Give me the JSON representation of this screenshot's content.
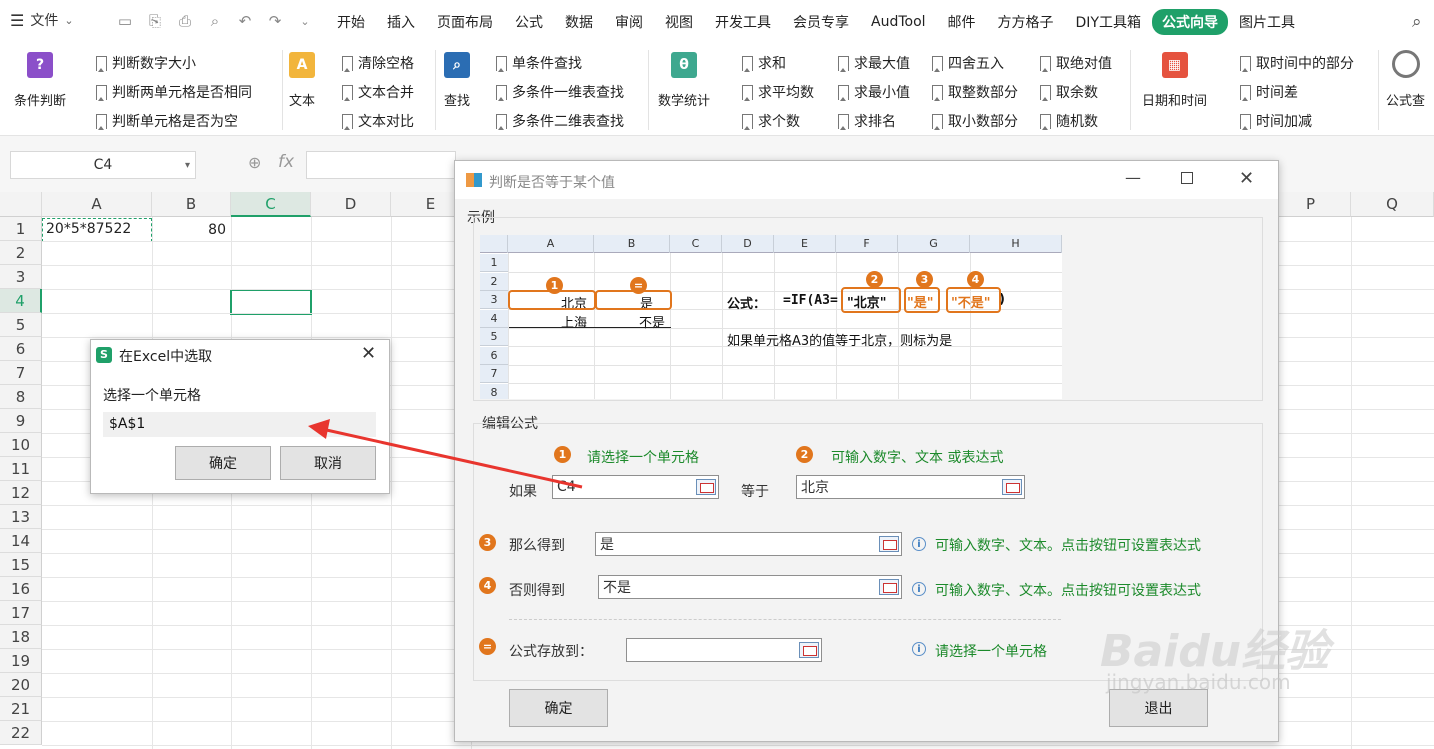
{
  "menubar": {
    "file_label": "文件",
    "tabs": [
      "开始",
      "插入",
      "页面布局",
      "公式",
      "数据",
      "审阅",
      "视图",
      "开发工具",
      "会员专享",
      "AudTool",
      "邮件",
      "方方格子",
      "DIY工具箱",
      "公式向导",
      "图片工具"
    ],
    "active_tab": "公式向导"
  },
  "ribbon": {
    "cond_label": "条件判断",
    "cond_items": [
      "判断数字大小",
      "判断两单元格是否相同",
      "判断单元格是否为空"
    ],
    "text_label": "文本",
    "text_items": [
      "清除空格",
      "文本合并",
      "文本对比"
    ],
    "find_label": "查找",
    "find_items": [
      "单条件查找",
      "多条件一维表查找",
      "多条件二维表查找"
    ],
    "math_label": "数学统计",
    "math_items": [
      "求和",
      "求平均数",
      "求个数"
    ],
    "math_items2": [
      "求最大值",
      "求最小值",
      "求排名"
    ],
    "math_items3": [
      "四舍五入",
      "取整数部分",
      "取小数部分"
    ],
    "math_items4": [
      "取绝对值",
      "取余数",
      "随机数"
    ],
    "date_label": "日期和时间",
    "date_items": [
      "取时间中的部分",
      "时间差",
      "时间加减"
    ],
    "formula_check_label": "公式查"
  },
  "fbar": {
    "namebox": "C4",
    "fx": "fx"
  },
  "grid": {
    "columns": [
      "A",
      "B",
      "C",
      "D",
      "E",
      "P",
      "Q"
    ],
    "rows": [
      "1",
      "2",
      "3",
      "4",
      "5",
      "6",
      "7",
      "8",
      "9",
      "10",
      "11",
      "12",
      "13",
      "14",
      "15",
      "16",
      "17",
      "18",
      "19",
      "20",
      "21",
      "22"
    ],
    "a1": "20*5*87522",
    "b1": "80"
  },
  "pick_dialog": {
    "title": "在Excel中选取",
    "prompt": "选择一个单元格",
    "value": "$A$1",
    "ok": "确定",
    "cancel": "取消"
  },
  "main_dialog": {
    "title": "判断是否等于某个值",
    "example_label": "示例",
    "example": {
      "cols": [
        "A",
        "B",
        "C",
        "D",
        "E",
        "F",
        "G",
        "H"
      ],
      "rows": [
        "1",
        "2",
        "3",
        "4",
        "5",
        "6",
        "7",
        "8"
      ],
      "a3": "北京",
      "b3": "是",
      "a4": "上海",
      "b4": "不是",
      "formula_label": "公式：",
      "formula_prefix": "=IF(A3=",
      "f_arg2": "\"北京\"",
      "f_arg3": "\"是\"",
      "f_arg4": "\"不是\"",
      "f_suffix": ")",
      "desc": "如果单元格A3的值等于北京，则标为是",
      "marks": [
        "1",
        "=",
        "2",
        "3",
        "4"
      ]
    },
    "edit_label": "编辑公式",
    "hint1": "请选择一个单元格",
    "hint2": "可输入数字、文本 或表达式",
    "if_label": "如果",
    "if_value": "C4",
    "equal_label": "等于",
    "equal_value": "北京",
    "then_label": "那么得到",
    "then_value": "是",
    "then_hint": "可输入数字、文本。点击按钮可设置表达式",
    "else_label": "否则得到",
    "else_value": "不是",
    "else_hint": "可输入数字、文本。点击按钮可设置表达式",
    "store_label": "公式存放到：",
    "store_value": "",
    "store_hint": "请选择一个单元格",
    "ok": "确定",
    "exit": "退出",
    "num1": "1",
    "num2": "2",
    "num3": "3",
    "num4": "4",
    "num5": "="
  },
  "watermark": {
    "text": "Baidu经验",
    "sub": "jingyan.baidu.com"
  },
  "colors": {
    "accent": "#1fa069",
    "orange": "#e1761d",
    "arrow": "#e8352e"
  }
}
